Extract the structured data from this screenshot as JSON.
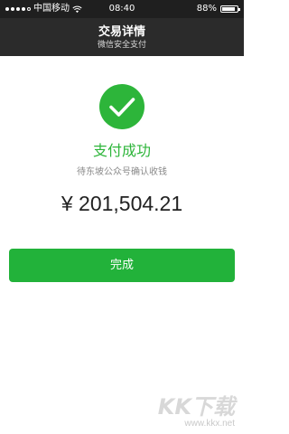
{
  "status_bar": {
    "carrier": "中国移动",
    "time": "08:40",
    "battery": "88%",
    "battery_level": 0.88,
    "signal_strength": 4
  },
  "nav": {
    "title": "交易详情",
    "subtitle": "微信安全支付"
  },
  "result": {
    "status": "支付成功",
    "merchant": "待东坡公众号确认收钱",
    "amount": "¥ 201,504.21",
    "icon": "checkmark-icon"
  },
  "actions": {
    "done_label": "完成"
  },
  "watermark": {
    "logo": "KK下载",
    "url": "www.kkx.net"
  },
  "colors": {
    "accent": "#2db53a",
    "button": "#22b23a",
    "nav_bg": "#2b2b2b",
    "status_bg": "#1f1f1f"
  }
}
